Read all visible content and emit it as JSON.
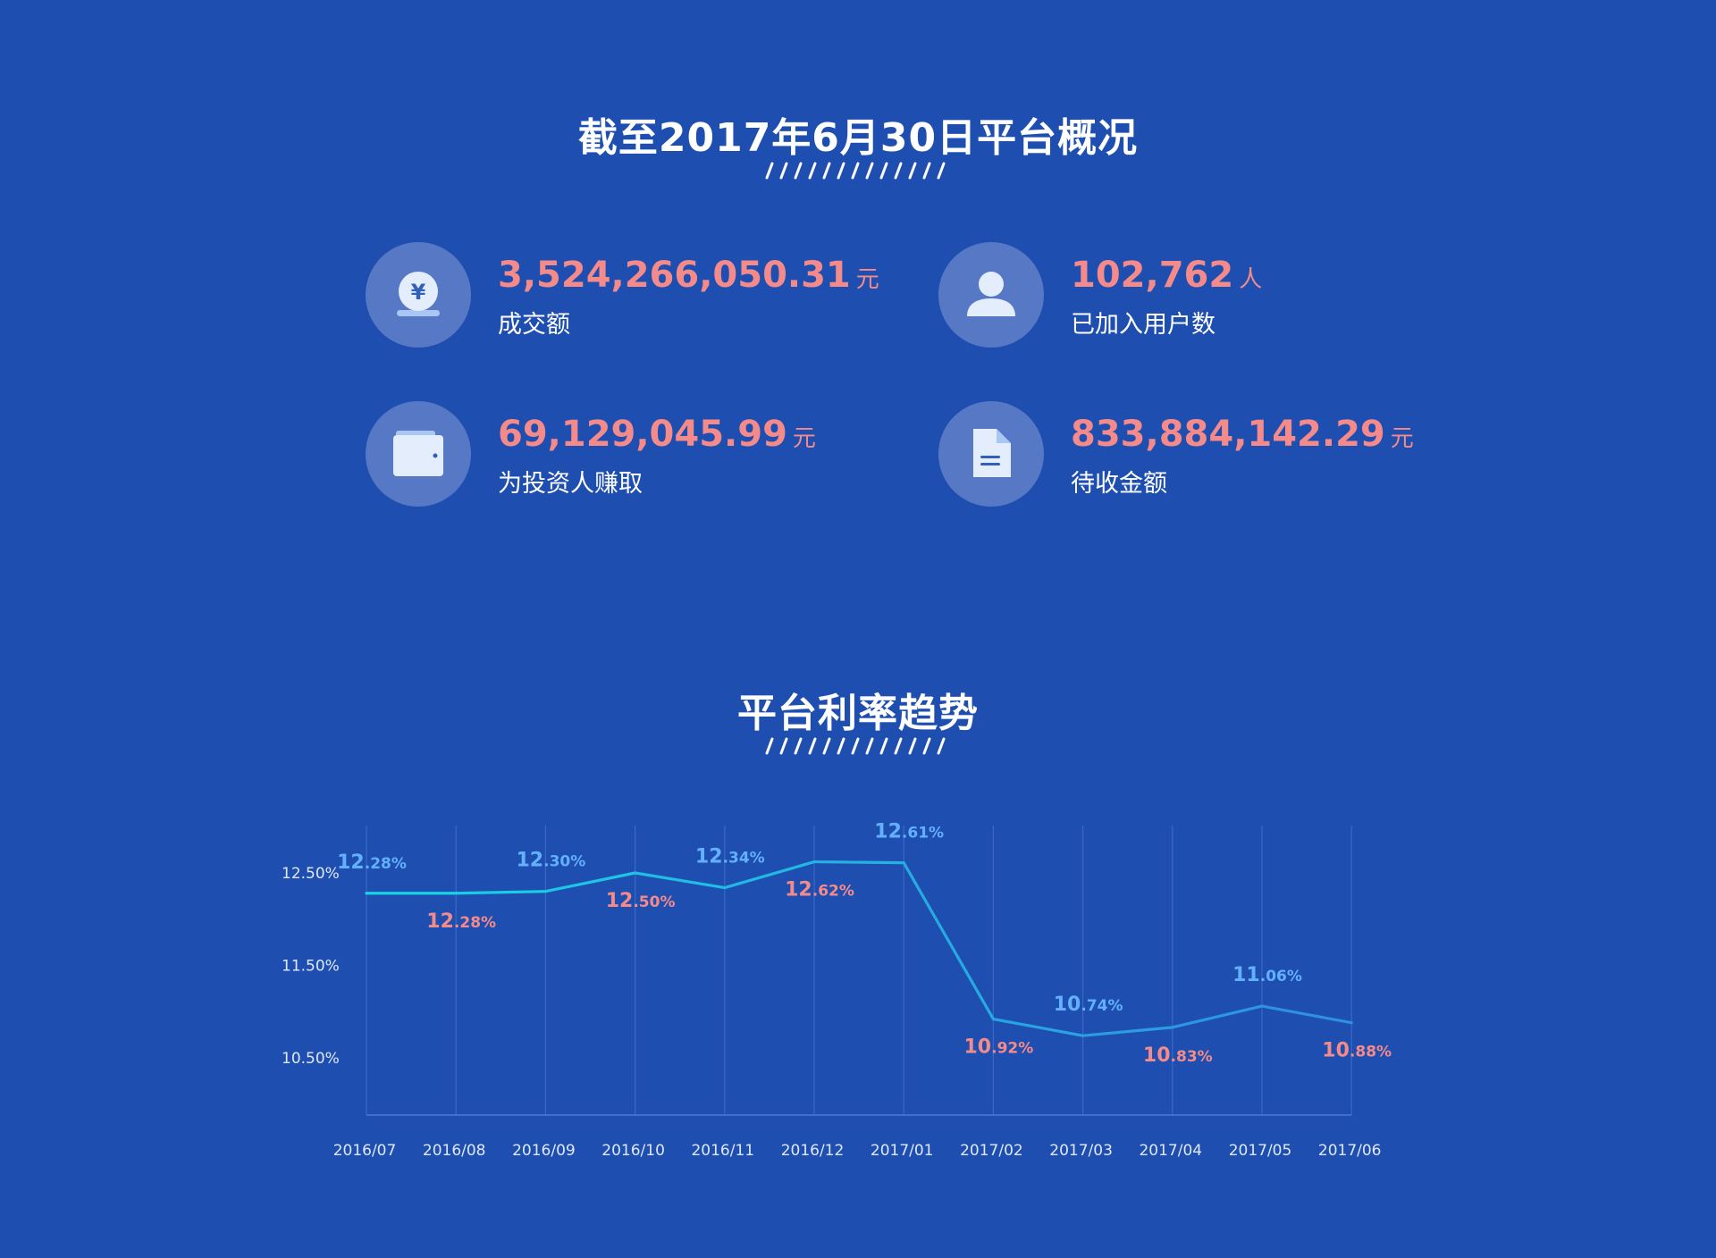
{
  "overview": {
    "title": "截至2017年6月30日平台概况",
    "stats": [
      {
        "value": "3,524,266,050.31",
        "unit": "元",
        "label": "成交额",
        "icon": "yuan-coin-icon"
      },
      {
        "value": "102,762",
        "unit": "人",
        "label": "已加入用户数",
        "icon": "user-icon"
      },
      {
        "value": "69,129,045.99",
        "unit": "元",
        "label": "为投资人赚取",
        "icon": "wallet-icon"
      },
      {
        "value": "833,884,142.29",
        "unit": "元",
        "label": "待收金额",
        "icon": "document-icon"
      }
    ]
  },
  "trend": {
    "title": "平台利率趋势"
  },
  "colors": {
    "background": "#1e4fb0",
    "accent_red": "#f58a8a",
    "accent_blue": "#63b0ff",
    "line_cyan": "#1ad2e6",
    "line_blue": "#2f8fe0",
    "icon_circle": "#5779c5"
  },
  "chart_data": {
    "type": "line",
    "categories": [
      "2016/07",
      "2016/08",
      "2016/09",
      "2016/10",
      "2016/11",
      "2016/12",
      "2017/01",
      "2017/02",
      "2017/03",
      "2017/04",
      "2017/05",
      "2017/06"
    ],
    "series": [
      {
        "values": [
          12.28,
          12.28,
          12.3,
          12.5,
          12.34,
          12.62,
          12.61,
          10.92,
          10.74,
          10.83,
          11.06,
          10.88
        ]
      }
    ],
    "data_labels": [
      "12.28%",
      "12.28%",
      "12.30%",
      "12.50%",
      "12.34%",
      "12.62%",
      "12.61%",
      "10.92%",
      "10.74%",
      "10.83%",
      "11.06%",
      "10.88%"
    ],
    "yticks": [
      "12.50%",
      "11.50%",
      "10.50%"
    ],
    "ytick_values": [
      12.5,
      11.5,
      10.5
    ],
    "ylim": [
      9.9,
      13.0
    ],
    "grid": true,
    "title": "",
    "xlabel": "",
    "ylabel": ""
  }
}
